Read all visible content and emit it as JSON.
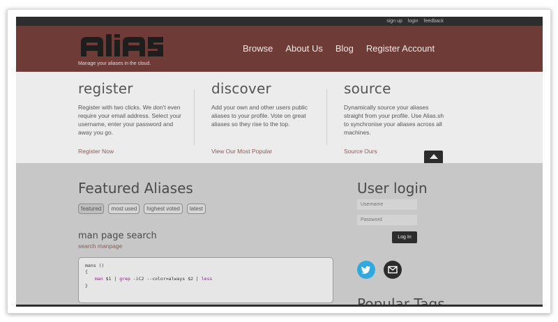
{
  "topbar": {
    "links": [
      "sign up",
      "login",
      "feedback"
    ]
  },
  "header": {
    "tagline": "Manage your aliases in the cloud.",
    "nav": [
      "Browse",
      "About Us",
      "Blog",
      "Register Account"
    ],
    "brand_color": "#6e3b37"
  },
  "intro": [
    {
      "title": "register",
      "text": "Register with two clicks. We don't even require your email address. Select your username, enter your password and away you go.",
      "link": "Register Now"
    },
    {
      "title": "discover",
      "text": "Add your own and other users public aliases to your profile. Vote on great aliases so they rise to the top.",
      "link": "View Our Most Popular"
    },
    {
      "title": "source",
      "text": "Dynamically source your aliases straight from your profile. Use Alias.sh to synchronise your aliases across all machines.",
      "link": "Source Ours"
    }
  ],
  "featured": {
    "title": "Featured Aliases",
    "filters": [
      "featured",
      "most used",
      "highest voted",
      "latest"
    ],
    "alias": {
      "title": "man page search",
      "link": "search manpage",
      "code": {
        "l1": "mans ()",
        "l2": "{",
        "l3a": "man",
        "l3b": " $1 | ",
        "l3c": "grep",
        "l3d": " -iC2 --color=always $2 | ",
        "l3e": "less",
        "l4": "}"
      }
    }
  },
  "login": {
    "title": "User login",
    "username_placeholder": "Username",
    "password_placeholder": "Password",
    "button": "Log In"
  },
  "popular_tags_title": "Popular Tags"
}
